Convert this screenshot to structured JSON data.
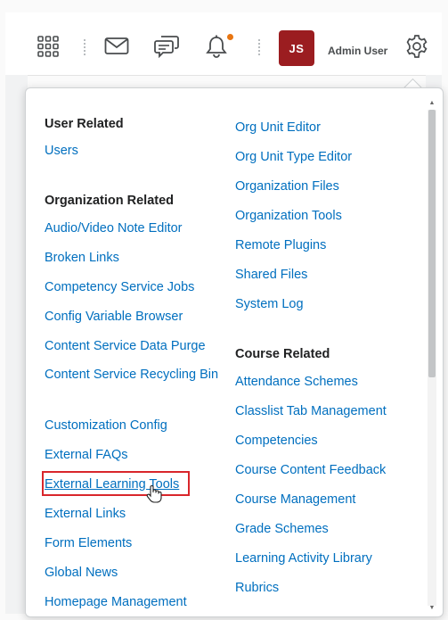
{
  "navbar": {
    "icons": [
      "apps-grid-icon",
      "mail-icon",
      "chat-icon",
      "bell-icon",
      "gear-icon"
    ],
    "avatar_initials": "JS",
    "user_name": "Admin User",
    "colors": {
      "avatar": "#9b1d20",
      "notification": "#e87511",
      "link": "#006fbf"
    }
  },
  "menu": {
    "left_column": {
      "user_related_heading": "User Related",
      "users": "Users",
      "org_related_heading": "Organization Related",
      "items": [
        "Audio/Video Note Editor",
        "Broken Links",
        "Competency Service Jobs",
        "Config Variable Browser",
        "Content Service Data Purge",
        "Content Service Recycling Bin",
        "Customization Config",
        "External FAQs",
        "External Learning Tools",
        "External Links",
        "Form Elements",
        "Global News",
        "Homepage Management"
      ]
    },
    "right_column": {
      "org_items": [
        "Org Unit Editor",
        "Org Unit Type Editor",
        "Organization Files",
        "Organization Tools",
        "Remote Plugins",
        "Shared Files",
        "System Log"
      ],
      "course_related_heading": "Course Related",
      "course_items": [
        "Attendance Schemes",
        "Classlist Tab Management",
        "Competencies",
        "Course Content Feedback",
        "Course Management",
        "Grade Schemes",
        "Learning Activity Library",
        "Rubrics"
      ]
    }
  }
}
